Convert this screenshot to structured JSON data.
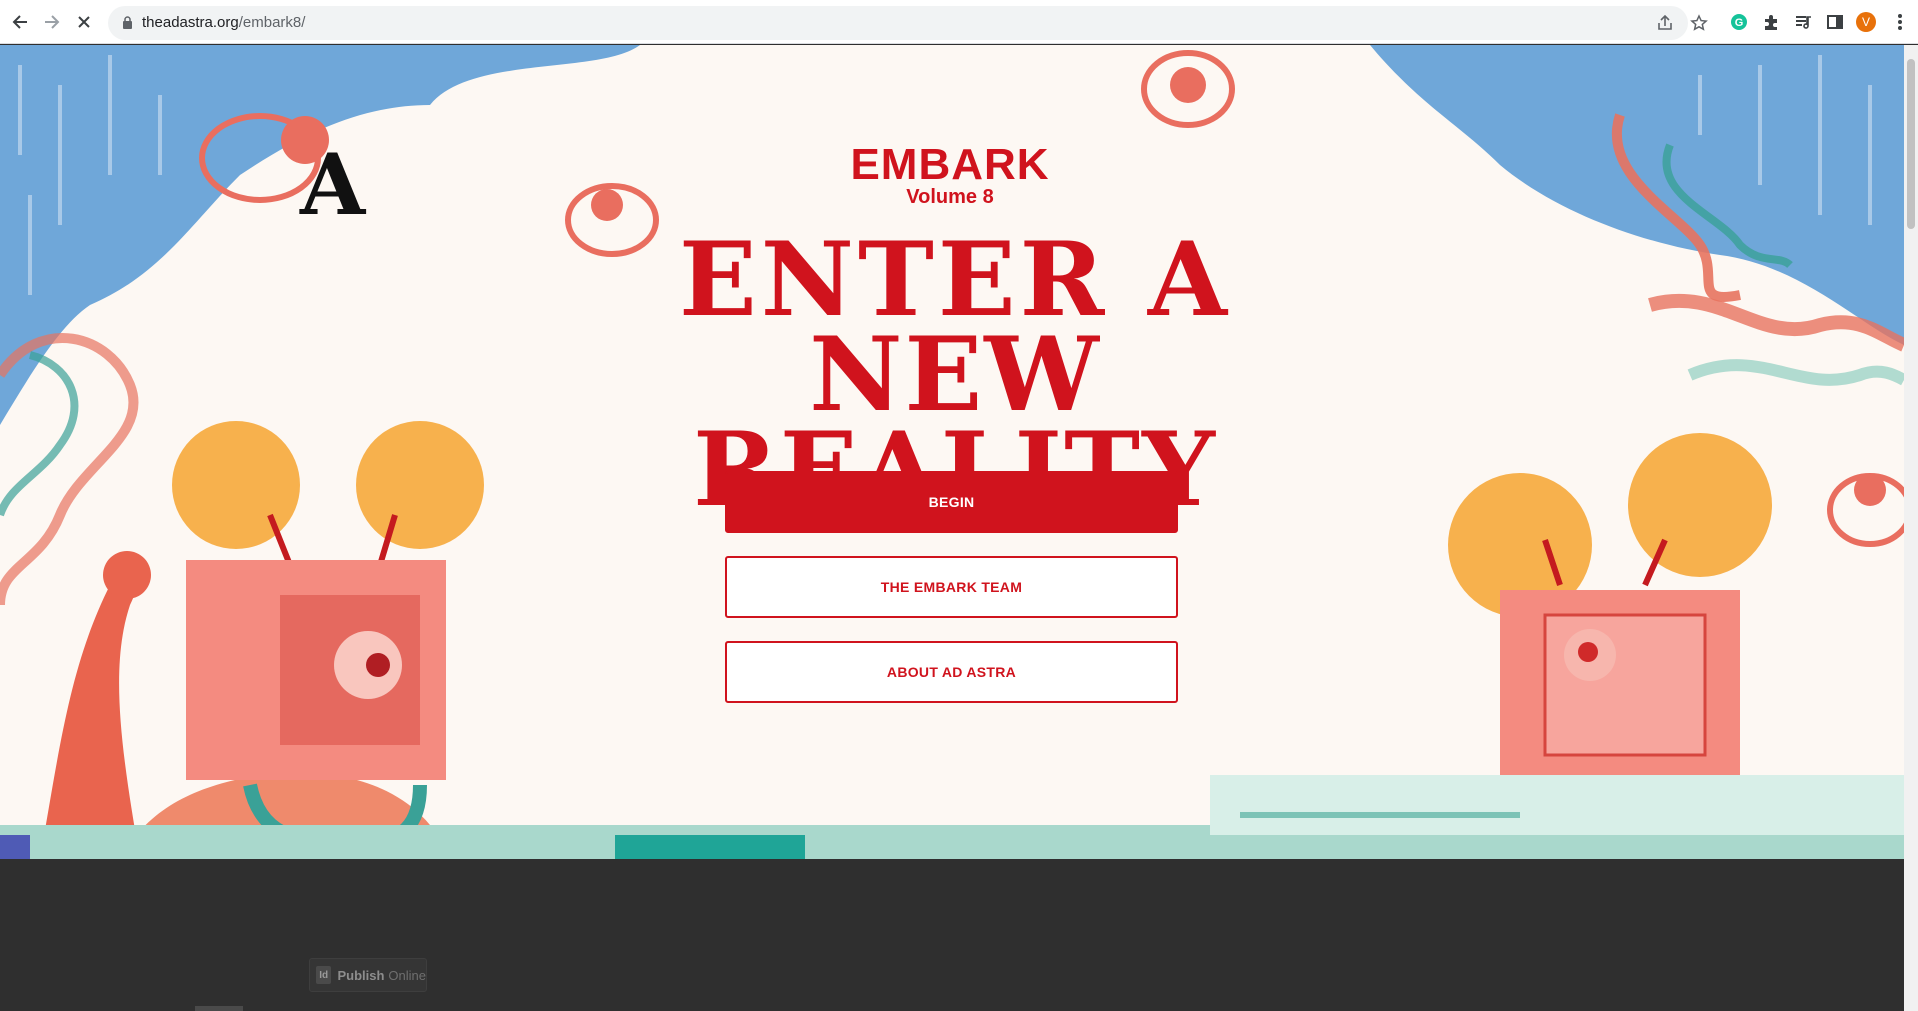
{
  "browser": {
    "url_domain": "theadastra.org",
    "url_path": "/embark8/",
    "profile_initial": "V",
    "accent_avatar": "#e8710a"
  },
  "hero": {
    "logo_letter": "A",
    "title": "EMBARK",
    "volume": "Volume 8",
    "headline_line1": "ENTER A",
    "headline_line2": "NEW REALITY",
    "brand_color": "#d0131d"
  },
  "buttons": {
    "begin": "BEGIN",
    "team": "THE EMBARK TEAM",
    "about": "ABOUT AD ASTRA"
  },
  "footer": {
    "badge_id": "Id",
    "publish_label": "Publish",
    "online_label": "Online"
  }
}
